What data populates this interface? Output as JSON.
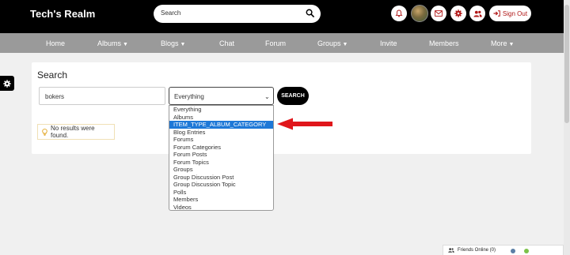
{
  "header": {
    "site_title": "Tech's Realm",
    "search_placeholder": "Search",
    "signout_label": "Sign Out"
  },
  "nav": {
    "items": [
      {
        "label": "Home",
        "has_caret": false
      },
      {
        "label": "Albums",
        "has_caret": true
      },
      {
        "label": "Blogs",
        "has_caret": true
      },
      {
        "label": "Chat",
        "has_caret": false
      },
      {
        "label": "Forum",
        "has_caret": false
      },
      {
        "label": "Groups",
        "has_caret": true
      },
      {
        "label": "Invite",
        "has_caret": false
      },
      {
        "label": "Members",
        "has_caret": false
      },
      {
        "label": "More",
        "has_caret": true
      }
    ]
  },
  "search": {
    "title": "Search",
    "query_value": "bokers",
    "type_selected": "Everything",
    "button_label": "SEARCH",
    "no_results": "No results were found.",
    "options": [
      "Everything",
      "Albums",
      "ITEM_TYPE_ALBUM_CATEGORY",
      "Blog Entries",
      "Forums",
      "Forum Categories",
      "Forum Posts",
      "Forum Topics",
      "Groups",
      "Group Discussion Post",
      "Group Discussion Topic",
      "Polls",
      "Members",
      "Videos"
    ],
    "highlighted_option_index": 2
  },
  "friends": {
    "label": "Friends Online (0)"
  },
  "colors": {
    "header_bg": "#000000",
    "nav_bg": "#9a9a9a",
    "accent_red": "#b01717",
    "selected_option": "#1e78d7",
    "annotation_arrow": "#e0161b"
  }
}
